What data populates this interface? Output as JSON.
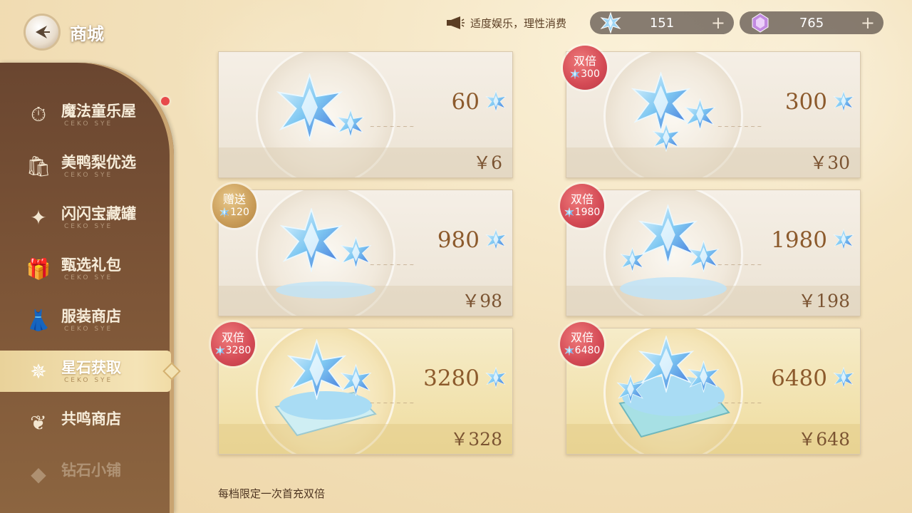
{
  "header": {
    "title": "商城",
    "notice": "适度娱乐，理性消费",
    "currencies": [
      {
        "icon": "star-stone-icon",
        "value": "151"
      },
      {
        "icon": "purple-gem-icon",
        "value": "765"
      }
    ]
  },
  "sidebar": {
    "items": [
      {
        "label": "魔法童乐屋",
        "sub": "CEKO SYE",
        "icon": "magic-house-icon"
      },
      {
        "label": "美鸭梨优选",
        "sub": "CEKO SYE",
        "icon": "shopping-bag-icon"
      },
      {
        "label": "闪闪宝藏罐",
        "sub": "CEKO SYE",
        "icon": "treasure-jar-icon"
      },
      {
        "label": "甄选礼包",
        "sub": "CEKO SYE",
        "icon": "gift-box-icon"
      },
      {
        "label": "服装商店",
        "sub": "CEKO SYE",
        "icon": "clothing-icon"
      },
      {
        "label": "星石获取",
        "sub": "CEKO SYE",
        "icon": "star-stone-icon"
      },
      {
        "label": "共鸣商店",
        "sub": "",
        "icon": "resonance-icon"
      },
      {
        "label": "钻石小铺",
        "sub": "",
        "icon": "diamond-shop-icon"
      }
    ],
    "active_index": 5
  },
  "cards": [
    {
      "amount": "60",
      "price": "￥6",
      "badge": null
    },
    {
      "amount": "300",
      "price": "￥30",
      "badge": {
        "label": "双倍",
        "bonus": "300",
        "color": "red"
      }
    },
    {
      "amount": "980",
      "price": "￥98",
      "badge": {
        "label": "赠送",
        "bonus": "120",
        "color": "gold"
      }
    },
    {
      "amount": "1980",
      "price": "￥198",
      "badge": {
        "label": "双倍",
        "bonus": "1980",
        "color": "red"
      }
    },
    {
      "amount": "3280",
      "price": "￥328",
      "badge": {
        "label": "双倍",
        "bonus": "3280",
        "color": "red"
      }
    },
    {
      "amount": "6480",
      "price": "￥648",
      "badge": {
        "label": "双倍",
        "bonus": "6480",
        "color": "red"
      }
    }
  ],
  "footer": {
    "note": "每档限定一次首充双倍"
  },
  "colors": {
    "accent_red": "#d44a55",
    "accent_gold": "#c99c58",
    "sidebar_brown": "#7d5537"
  }
}
